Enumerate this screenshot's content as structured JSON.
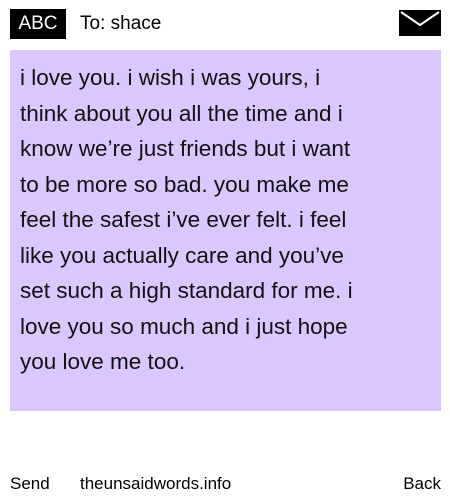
{
  "header": {
    "input_mode": "ABC",
    "recipient_label": "To: shace",
    "message_icon": "envelope-icon"
  },
  "message": {
    "body": "i love you. i wish i was yours, i\nthink about you all the time and i\nknow we’re just friends but i want\nto be more so bad. you make me\nfeel the safest i’ve ever felt. i feel\nlike you actually care and you’ve\nset such a high standard for me. i\nlove you so much and i just hope\nyou love me too.",
    "background_color": "#dcc6fe"
  },
  "softkeys": {
    "left": "Send",
    "center": "theunsaidwords.info",
    "right": "Back"
  }
}
